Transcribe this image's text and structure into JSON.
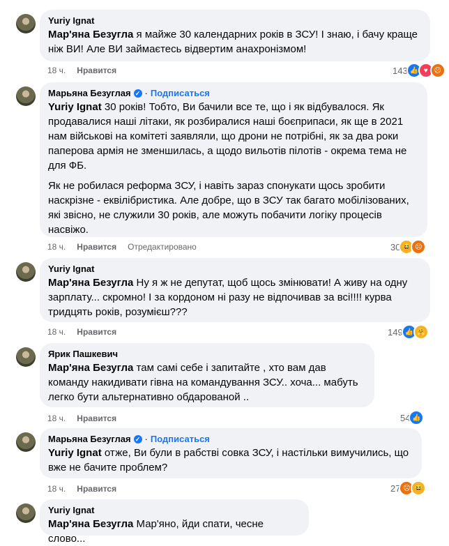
{
  "comments": [
    {
      "author": "Yuriy Ignat",
      "mention": "Мар'яна Безугла",
      "text": " я майже 30 календарних років в ЗСУ! І знаю, і бачу краще ніж ВИ! Але ВИ займаєтесь відвертим анахронізмом!",
      "time": "18 ч.",
      "like": "Нравится",
      "reactions_count": "143",
      "reactions": [
        "like",
        "love",
        "angry"
      ]
    },
    {
      "author": "Марьяна Безуглая",
      "follow": "Подписаться",
      "mention": "Yuriy Ignat",
      "text": " 30 років! Тобто, Ви бачили все те, що і як відбувалося. Як продавалися наші літаки, як розбиралися наші боєприпаси, як ще в 2021 нам військові на комітеті заявляли, що дрони не потрібні, як за два роки паперова армія не зменшилась, а щодо вильотів пілотів - окрема тема не для ФБ.",
      "text2": "Як не робилася реформа ЗСУ, і навіть зараз спонукати щось зробити наскрізне - еквілібристика. Але добре, що в ЗСУ так багато мобілізованих, які звісно, не служили 30 років, але можуть побачити логіку процесів насвіжо.",
      "time": "18 ч.",
      "like": "Нравится",
      "edited": "Отредактировано",
      "reactions_count": "30",
      "reactions": [
        "haha",
        "angry"
      ]
    },
    {
      "author": "Yuriy Ignat",
      "mention": "Мар'яна Безугла",
      "text": " Ну я ж не депутат, щоб щось змінювати! А живу на одну зарплату... скромно! І за кордоном ні разу не відпочивав за всі!!!! курва тридцять років, розумієш???",
      "time": "18 ч.",
      "like": "Нравится",
      "reactions_count": "149",
      "reactions": [
        "like",
        "care"
      ]
    },
    {
      "author": "Ярик Пашкевич",
      "mention": "Мар'яна Безугла",
      "text": " там самі себе і запитайте , хто вам дав команду накидивати гівна на командування ЗСУ.. хоча... мабуть легко бути альтернативно обдарованой ..",
      "time": "18 ч.",
      "like": "Нравится",
      "reactions_count": "54",
      "reactions": [
        "like"
      ]
    },
    {
      "author": "Марьяна Безуглая",
      "follow": "Подписаться",
      "mention": "Yuriy Ignat",
      "text": " отже, Ви були в рабстві совка ЗСУ, і настільки вимучились, що вже не бачите проблем?",
      "time": "18 ч.",
      "like": "Нравится",
      "reactions_count": "27",
      "reactions": [
        "angry",
        "haha"
      ]
    },
    {
      "author": "Yuriy Ignat",
      "mention": "Мар'яна Безугла",
      "text": " Мар'яно, йди спати, чесне слово..."
    }
  ],
  "colors": {
    "accent": "#1877f2",
    "bubble": "#f0f2f5",
    "meta": "#65676b"
  }
}
